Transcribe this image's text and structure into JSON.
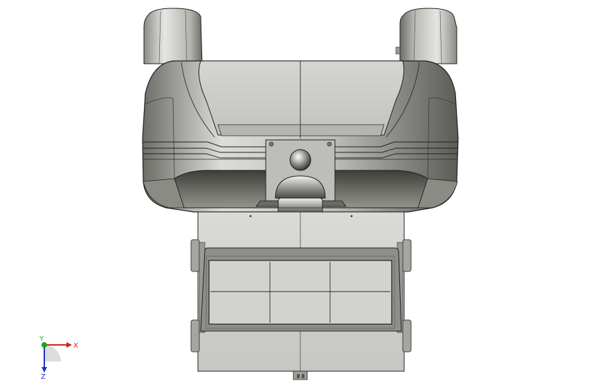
{
  "viewport": {
    "colors": {
      "background": "#ffffff",
      "shell_light": "#d9d9d7",
      "shell_mid": "#a9a9a5",
      "shell_dark": "#54544f",
      "plate": "#cfcfcc",
      "edge": "#1e1e1e"
    }
  },
  "triad": {
    "x_label": "X",
    "y_label": "Y",
    "z_label": "Z",
    "colors": {
      "x": "#d62020",
      "y": "#20a020",
      "z": "#2030c0"
    }
  }
}
